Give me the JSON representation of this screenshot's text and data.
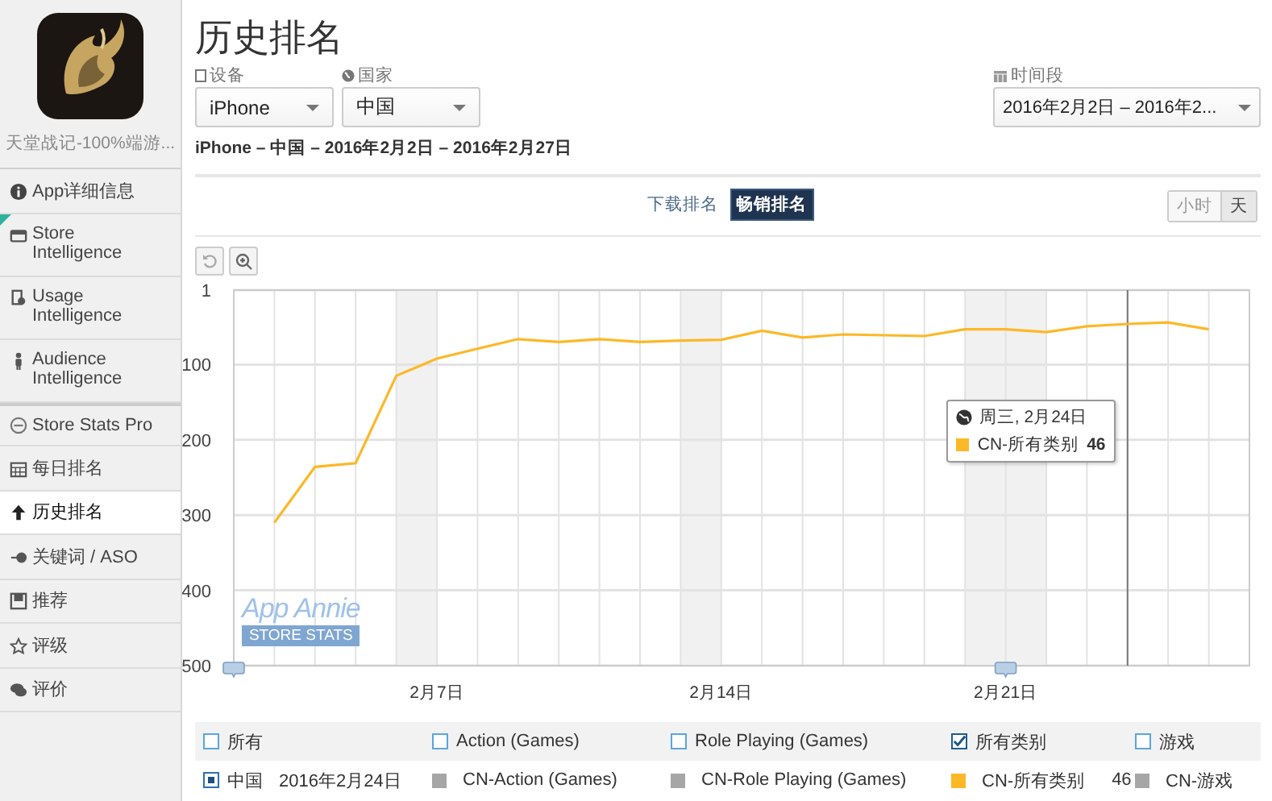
{
  "sidebar": {
    "app_name": "天堂战记-100%端游...",
    "items": [
      {
        "label": "App详细信息",
        "selected": false
      },
      {
        "label": "Store Intelligence",
        "selected": false
      },
      {
        "label": "Usage Intelligence",
        "selected": false
      },
      {
        "label": "Audience Intelligence",
        "selected": false
      },
      {
        "label": "Store Stats Pro",
        "selected": false
      },
      {
        "label": "每日排名",
        "selected": false
      },
      {
        "label": "历史排名",
        "selected": true
      },
      {
        "label": "关键词 / ASO",
        "selected": false
      },
      {
        "label": "推荐",
        "selected": false
      },
      {
        "label": "评级",
        "selected": false
      },
      {
        "label": "评价",
        "selected": false
      }
    ]
  },
  "title": "历史排名",
  "filters": [
    {
      "label": "设备",
      "value": "iPhone"
    },
    {
      "label": "国家",
      "value": "中国"
    }
  ],
  "period": {
    "label": "时间段",
    "value": "2016年2月2日 – 2016年2..."
  },
  "summary": "iPhone – 中国 – 2016年2月2日 – 2016年2月27日",
  "rank_tabs": [
    {
      "label": "下载排名",
      "selected": false
    },
    {
      "label": "畅销排名",
      "selected": true
    }
  ],
  "interval": [
    {
      "label": "小时",
      "selected": false
    },
    {
      "label": "天",
      "selected": true
    }
  ],
  "chart": {
    "watermark": {
      "brand": "App Annie",
      "label": "STORE STATS"
    },
    "tooltip": {
      "title": "周三, 2月24日",
      "value": "46"
    },
    "chart_data": {
      "type": "line",
      "grid": true,
      "categories": [
        null,
        null,
        null,
        null,
        null,
        "2月7日",
        null,
        null,
        null,
        null,
        null,
        null,
        "2月14日",
        null,
        null,
        null,
        null,
        null,
        null,
        "2月21日",
        null,
        null,
        null,
        null,
        null,
        null
      ],
      "ylim": [
        500,
        1
      ],
      "yticks": [
        1,
        100,
        200,
        300,
        400,
        500
      ],
      "series": [
        {
          "name": "CN-所有类别",
          "color": "#fdb827",
          "values": [
            null,
            310,
            236,
            231,
            115,
            92,
            79,
            66,
            70,
            66,
            70,
            68,
            67,
            55,
            64,
            60,
            61,
            62,
            53,
            53,
            57,
            49,
            46,
            44,
            53,
            null
          ]
        }
      ]
    }
  },
  "legend": {
    "country": {
      "label": "中国",
      "selected": true,
      "date": "2016年2月24日"
    },
    "items": [
      {
        "label": "所有",
        "checked": false
      },
      {
        "label": "Action (Games)",
        "checked": false,
        "series": "CN-Action (Games)",
        "color": "#a6a6a6"
      },
      {
        "label": "Role Playing (Games)",
        "checked": false,
        "series": "CN-Role Playing (Games)",
        "color": "#a6a6a6"
      },
      {
        "label": "所有类别",
        "checked": true,
        "series": "CN-所有类别",
        "color": "#fdb827",
        "value": "46"
      },
      {
        "label": "游戏",
        "checked": false,
        "series": "CN-游戏",
        "color": "#a6a6a6"
      }
    ]
  }
}
